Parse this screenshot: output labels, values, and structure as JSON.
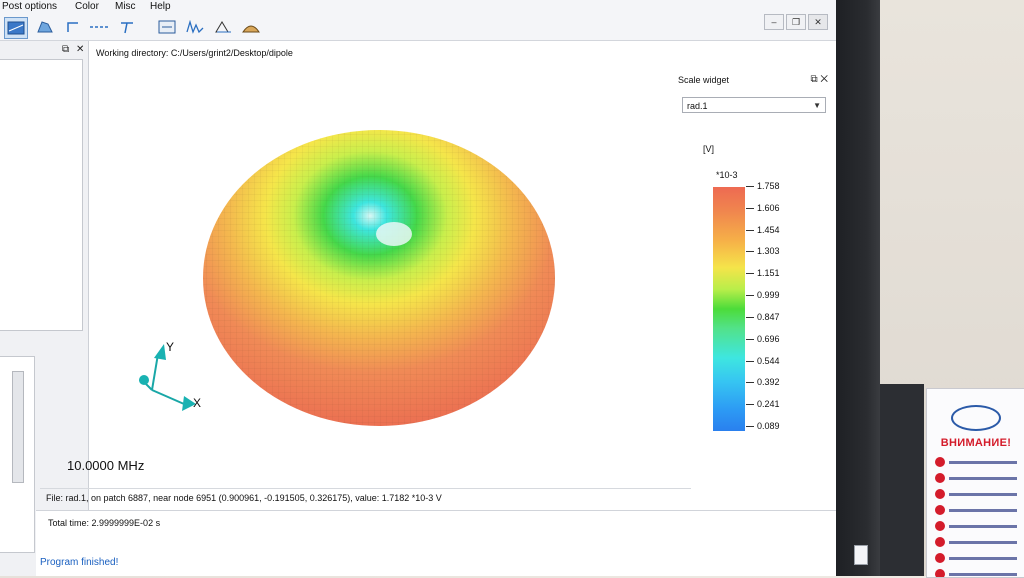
{
  "menu": {
    "post_options": "Post options",
    "color": "Color",
    "misc": "Misc",
    "help": "Help"
  },
  "window_controls": {
    "minimize": "–",
    "restore": "❐",
    "close": "✕"
  },
  "working_directory": "Working directory: C:/Users/grint2/Desktop/dipole",
  "scale_widget": {
    "title": "Scale widget",
    "selected": "rad.1",
    "unit": "[V]",
    "multiplier": "*10-3",
    "values": [
      "1.758",
      "1.606",
      "1.454",
      "1.303",
      "1.151",
      "0.999",
      "0.847",
      "0.696",
      "0.544",
      "0.392",
      "0.241",
      "0.089"
    ]
  },
  "axes": {
    "y": "Y",
    "x": "X"
  },
  "frequency": "10.0000 MHz",
  "pick_info": "File: rad.1, on patch 6887, near node 6951 (0.900961, -0.191505, 0.326175), value: 1.7182 *10-3 V",
  "total_time": "Total time:   2.9999999E-02  s",
  "status": "Program finished!",
  "poster": {
    "title": "ВНИМАНИЕ!"
  },
  "colors": {
    "accent": "#1a60c0",
    "high": "#ee6a52",
    "low": "#2a80ee"
  }
}
